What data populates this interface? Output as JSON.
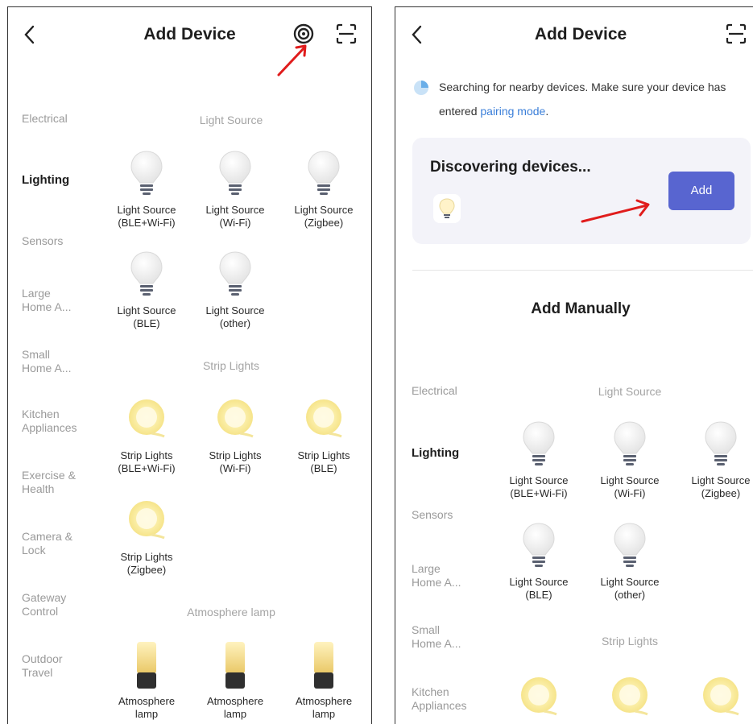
{
  "left_screen": {
    "header": {
      "title": "Add Device",
      "back_icon": "chevron-left-icon",
      "scan_target_icon": "target-icon",
      "scan_icon": "scan-icon"
    },
    "categories": [
      "Electrical",
      "Lighting",
      "Sensors",
      "Large\nHome A...",
      "Small\nHome A...",
      "Kitchen\nAppliances",
      "Exercise &\nHealth",
      "Camera &\nLock",
      "Gateway\nControl",
      "Outdoor\nTravel"
    ],
    "active_category": "Lighting",
    "sections": {
      "light_source": "Light Source",
      "strip_lights": "Strip Lights",
      "atmosphere": "Atmosphere lamp"
    },
    "light_devices": [
      "Light Source\n(BLE+Wi-Fi)",
      "Light Source\n(Wi-Fi)",
      "Light Source\n(Zigbee)",
      "Light Source\n(BLE)",
      "Light Source\n(other)"
    ],
    "strip_devices": [
      "Strip Lights\n(BLE+Wi-Fi)",
      "Strip Lights\n(Wi-Fi)",
      "Strip Lights\n(BLE)",
      "Strip Lights\n(Zigbee)"
    ],
    "lamp_devices": [
      "Atmosphere\nlamp",
      "Atmosphere\nlamp",
      "Atmosphere\nlamp"
    ]
  },
  "right_screen": {
    "header": {
      "title": "Add Device",
      "back_icon": "chevron-left-icon",
      "scan_icon": "scan-icon"
    },
    "search": {
      "prefix": "Searching for nearby devices. Make sure your device has entered ",
      "link": "pairing mode",
      "suffix": "."
    },
    "discovering": {
      "title": "Discovering devices...",
      "add_label": "Add"
    },
    "add_manually": "Add Manually",
    "categories": [
      "Electrical",
      "Lighting",
      "Sensors",
      "Large\nHome A...",
      "Small\nHome A...",
      "Kitchen\nAppliances"
    ],
    "active_category": "Lighting",
    "sections": {
      "light_source": "Light Source",
      "strip_lights": "Strip Lights"
    },
    "light_devices": [
      "Light Source\n(BLE+Wi-Fi)",
      "Light Source\n(Wi-Fi)",
      "Light Source\n(Zigbee)",
      "Light Source\n(BLE)",
      "Light Source\n(other)"
    ]
  },
  "colors": {
    "accent": "#5865d0",
    "link": "#3b7fd9",
    "annotation_arrow": "#e01c1c",
    "card_bg": "#f3f3f9"
  }
}
